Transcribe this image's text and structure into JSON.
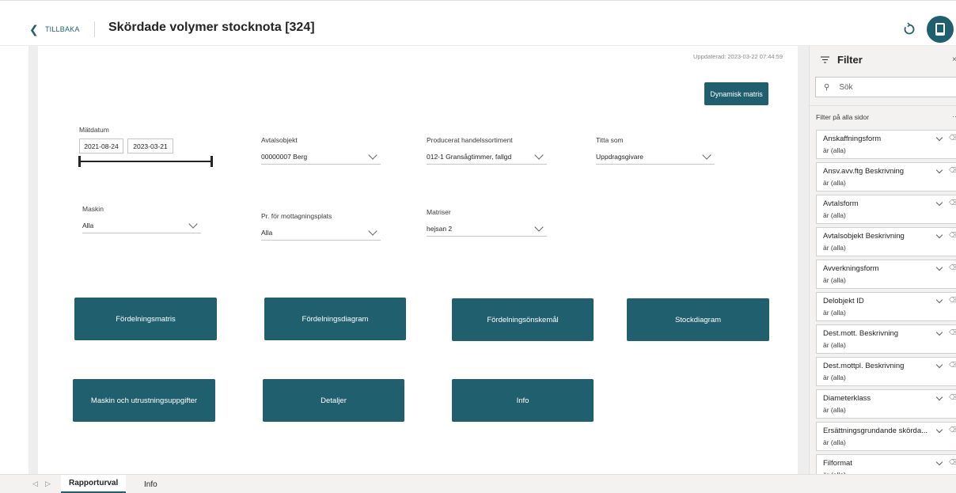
{
  "header": {
    "back_label": "TILLBAKA",
    "title": "Skördade volymer stocknota [324]"
  },
  "canvas": {
    "updated": "Uppdaterad: 2023-03-22 07:44:59",
    "dynamic_button": "Dynamisk matris",
    "matdatum": {
      "label": "Mätdatum",
      "from": "2021-08-24",
      "to": "2023-03-21"
    },
    "avtalsobjekt": {
      "label": "Avtalsobjekt",
      "value": "00000007 Berg"
    },
    "sortiment": {
      "label": "Producerat handelssortiment",
      "value": "012-1 Gransågtimmer, fallgd"
    },
    "titta_som": {
      "label": "Titta som",
      "value": "Uppdragsgivare"
    },
    "maskin": {
      "label": "Maskin",
      "value": "Alla"
    },
    "mottagning": {
      "label": "Pr. för mottagningsplats",
      "value": "Alla"
    },
    "matriser": {
      "label": "Matriser",
      "value": "hejsan 2"
    },
    "tiles": [
      "Fördelningsmatris",
      "Fördelningsdiagram",
      "Fördelningsönskemål",
      "Stockdiagram",
      "Maskin och utrustningsuppgifter",
      "Detaljer",
      "Info"
    ]
  },
  "tabs": [
    "Rapporturval",
    "Info"
  ],
  "filter": {
    "title": "Filter",
    "search_placeholder": "Sök",
    "all_pages_label": "Filter på alla sidor",
    "items": [
      {
        "name": "Anskaffningsform",
        "state": "är (alla)"
      },
      {
        "name": "Ansv.avv.ftg Beskrivning",
        "state": "är (alla)"
      },
      {
        "name": "Avtalsform",
        "state": "är (alla)"
      },
      {
        "name": "Avtalsobjekt Beskrivning",
        "state": "är (alla)"
      },
      {
        "name": "Avverkningsform",
        "state": "är (alla)"
      },
      {
        "name": "Delobjekt ID",
        "state": "är (alla)"
      },
      {
        "name": "Dest.mott. Beskrivning",
        "state": "är (alla)"
      },
      {
        "name": "Dest.mottpl. Beskrivning",
        "state": "är (alla)"
      },
      {
        "name": "Diameterklass",
        "state": "är (alla)"
      },
      {
        "name": "Ersättningsgrundande skörda...",
        "state": "är (alla)"
      },
      {
        "name": "Filformat",
        "state": "är (alla)"
      }
    ]
  },
  "colors": {
    "accent": "#1f5f6e"
  }
}
